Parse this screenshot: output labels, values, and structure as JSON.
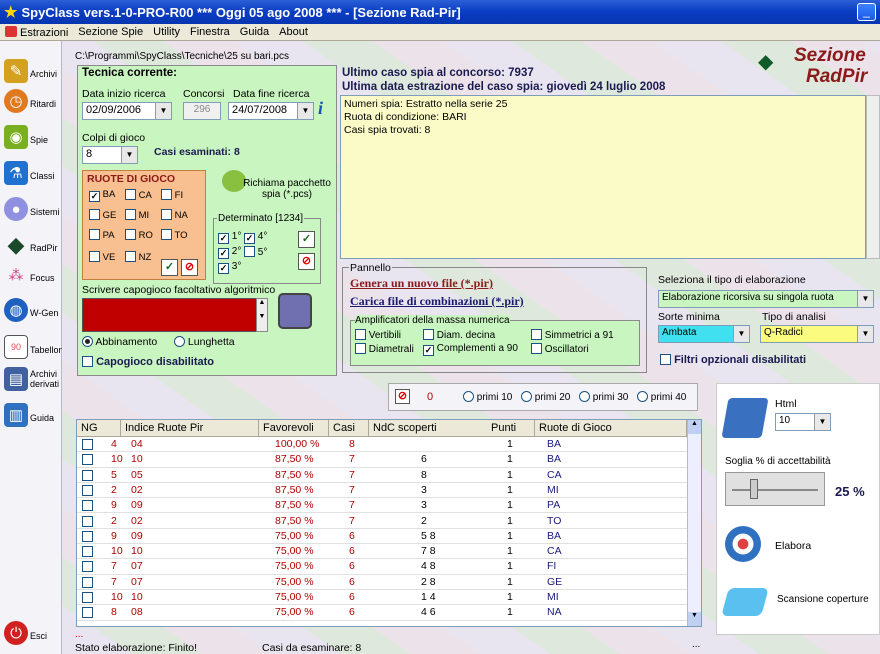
{
  "window": {
    "title": "SpyClass vers.1-0-PRO-R00  ***  Oggi 05 ago 2008  ***   - [Sezione Rad-Pir]",
    "minimize": "_"
  },
  "menu": [
    "Estrazioni",
    "Sezione Spie",
    "Utility",
    "Finestra",
    "Guida",
    "About"
  ],
  "sidebar": [
    {
      "label": "Archivi",
      "icon": "pencil-icon",
      "color": "#d4a020"
    },
    {
      "label": "Ritardi",
      "icon": "clock-icon",
      "color": "#e07a20"
    },
    {
      "label": "Spie",
      "icon": "flashlight-icon",
      "color": "#7ab020"
    },
    {
      "label": "Classi",
      "icon": "flask-icon",
      "color": "#2070d0"
    },
    {
      "label": "Sistemi",
      "icon": "bulb-icon",
      "color": "#9090e0"
    },
    {
      "label": "RadPir",
      "icon": "pyramid-icon",
      "color": "#1a4a2a"
    },
    {
      "label": "Focus",
      "icon": "dots-icon",
      "color": "#d04080"
    },
    {
      "label": "W-Gen",
      "icon": "globe-icon",
      "color": "#2060c0"
    },
    {
      "label": "Tabellone",
      "icon": "board-icon",
      "color": "#e05050"
    },
    {
      "label": "Archivi derivati",
      "icon": "archive-icon",
      "color": "#4060a0"
    },
    {
      "label": "Guida",
      "icon": "book-icon",
      "color": "#3070c0"
    },
    {
      "label": "Esci",
      "icon": "exit-icon",
      "color": "#d02020"
    }
  ],
  "file_path": "C:\\Programmi\\SpyClass\\Tecniche\\25 su bari.pcs",
  "section_logo": {
    "line1": "Sezione",
    "line2": "RadPir"
  },
  "technique": {
    "title": "Tecnica corrente:",
    "start_label": "Data inizio ricerca",
    "start_value": "02/09/2006",
    "contests_label": "Concorsi",
    "contests_value": "296",
    "end_label": "Data fine ricerca",
    "end_value": "24/07/2008",
    "info_icon": "i",
    "shots_label": "Colpi di gioco",
    "shots_value": "8",
    "cases_label": "Casi esaminati: 8",
    "wheels_title": "RUOTE DI GIOCO",
    "wheels": [
      {
        "n": "BA",
        "on": true
      },
      {
        "n": "CA",
        "on": false
      },
      {
        "n": "FI",
        "on": false
      },
      {
        "n": "GE",
        "on": false
      },
      {
        "n": "MI",
        "on": false
      },
      {
        "n": "NA",
        "on": false
      },
      {
        "n": "PA",
        "on": false
      },
      {
        "n": "RO",
        "on": false
      },
      {
        "n": "TO",
        "on": false
      },
      {
        "n": "VE",
        "on": false
      },
      {
        "n": "NZ",
        "on": false
      }
    ],
    "recall_label": "Richiama pacchetto spia (*.pcs)",
    "determ_title": "Determinato [1234]",
    "determ": [
      {
        "n": "1°",
        "on": true
      },
      {
        "n": "4°",
        "on": true
      },
      {
        "n": "2°",
        "on": true
      },
      {
        "n": "5°",
        "on": false
      },
      {
        "n": "3°",
        "on": true
      }
    ],
    "algo_label": "Scrivere capogioco facoltativo algoritmico",
    "radio1": "Abbinamento",
    "radio2": "Lunghetta",
    "capo_label": "Capogioco disabilitato"
  },
  "last_case": "Ultimo caso spia al concorso: 7937",
  "last_date": "Ultima data estrazione del caso spia: giovedì 24 luglio 2008",
  "info_lines": [
    "Numeri spia: Estratto nella serie 25",
    "Ruota di condizione: BARI",
    "Casi spia trovati: 8"
  ],
  "pannello": {
    "title": "Pannello",
    "gen_link": "Genera un nuovo file  (*.pir)",
    "load_link": "Carica file di combinazioni  (*.pir)",
    "amp_title": "Amplificatori della massa numerica",
    "amps": [
      {
        "n": "Vertibili",
        "on": false
      },
      {
        "n": "Diam. decina",
        "on": false
      },
      {
        "n": "Simmetrici a 91",
        "on": false
      },
      {
        "n": "Diametrali",
        "on": false
      },
      {
        "n": "Complementi a 90",
        "on": true
      },
      {
        "n": "Oscillatori",
        "on": false
      }
    ],
    "type_label": "Seleziona il tipo di elaborazione",
    "type_value": "Elaborazione ricorsiva su singola ruota",
    "sorte_label": "Sorte minima",
    "sorte_value": "Ambata",
    "analysis_label": "Tipo di analisi",
    "analysis_value": "Q-Radici",
    "filters_label": "Filtri opzionali disabilitati"
  },
  "primi": {
    "count": "0",
    "opts": [
      "primi 10",
      "primi 20",
      "primi 30",
      "primi 40"
    ]
  },
  "grid": {
    "headers": [
      "NG",
      "Indice Ruote Pir",
      "Favorevoli",
      "Casi",
      "NdC scoperti",
      "Punti",
      "Ruote di Gioco"
    ],
    "rows": [
      [
        "4",
        "04",
        "100,00 %",
        "8",
        "",
        "1",
        "BA"
      ],
      [
        "10",
        "10",
        "87,50 %",
        "7",
        "6",
        "1",
        "BA"
      ],
      [
        "5",
        "05",
        "87,50 %",
        "7",
        "8",
        "1",
        "CA"
      ],
      [
        "2",
        "02",
        "87,50 %",
        "7",
        "3",
        "1",
        "MI"
      ],
      [
        "9",
        "09",
        "87,50 %",
        "7",
        "3",
        "1",
        "PA"
      ],
      [
        "2",
        "02",
        "87,50 %",
        "7",
        "2",
        "1",
        "TO"
      ],
      [
        "9",
        "09",
        "75,00 %",
        "6",
        "5 8",
        "1",
        "BA"
      ],
      [
        "10",
        "10",
        "75,00 %",
        "6",
        "7 8",
        "1",
        "CA"
      ],
      [
        "7",
        "07",
        "75,00 %",
        "6",
        "4 8",
        "1",
        "FI"
      ],
      [
        "7",
        "07",
        "75,00 %",
        "6",
        "2 8",
        "1",
        "GE"
      ],
      [
        "10",
        "10",
        "75,00 %",
        "6",
        "1 4",
        "1",
        "MI"
      ],
      [
        "8",
        "08",
        "75,00 %",
        "6",
        "4 6",
        "1",
        "NA"
      ]
    ]
  },
  "right": {
    "html_label": "Html",
    "html_value": "10",
    "threshold_label": "Soglia % di accettabilità",
    "threshold_value": "25 %",
    "elabora": "Elabora",
    "scan": "Scansione coperture"
  },
  "status": {
    "state": "Stato elaborazione:  Finito!",
    "remaining": "Casi da esaminare: 8",
    "dots": "..."
  }
}
